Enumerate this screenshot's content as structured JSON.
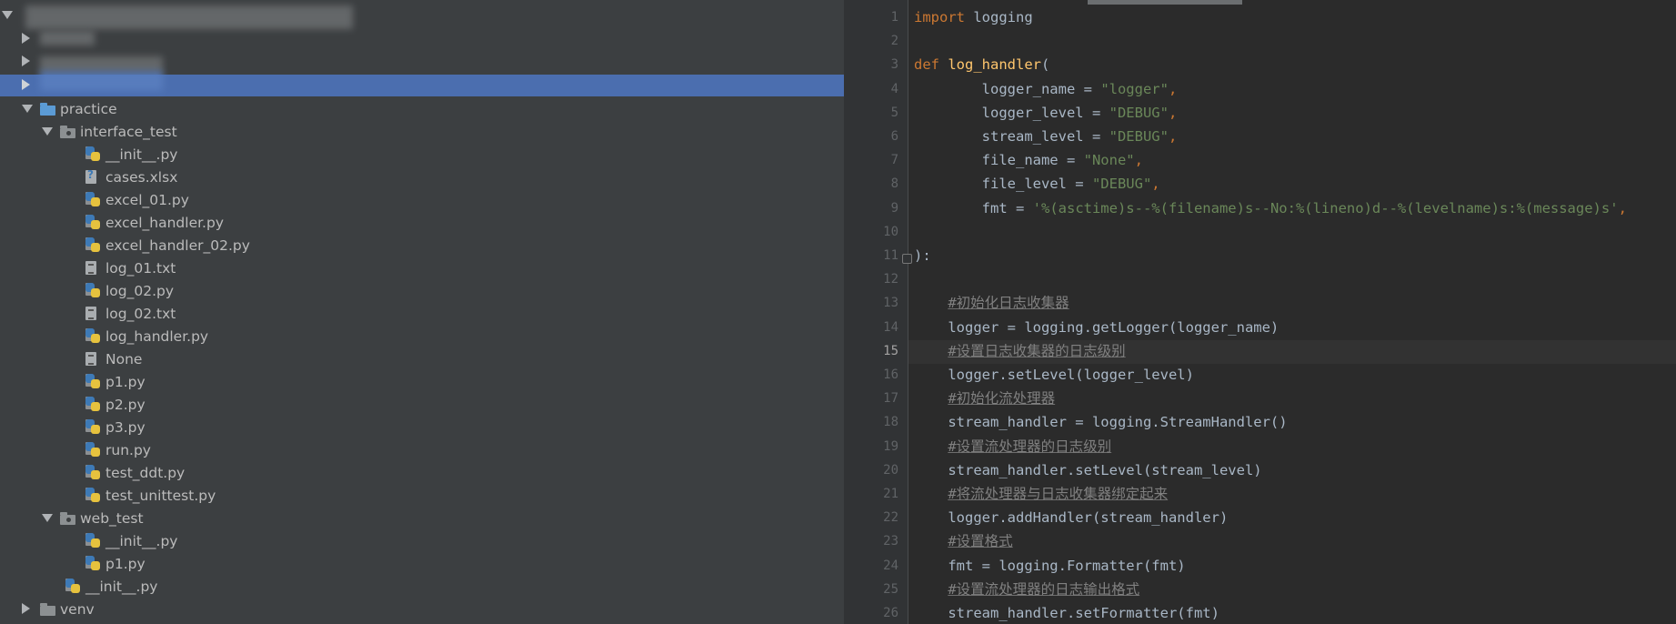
{
  "tree": {
    "items": [
      {
        "label": "practice",
        "depth": 1,
        "icon": "folder-icon",
        "arrow": "down"
      },
      {
        "label": "interface_test",
        "depth": 2,
        "icon": "package-folder-icon",
        "arrow": "down"
      },
      {
        "label": "__init__.py",
        "depth": 3,
        "icon": "python-file-icon"
      },
      {
        "label": "cases.xlsx",
        "depth": 3,
        "icon": "unknown-file-icon"
      },
      {
        "label": "excel_01.py",
        "depth": 3,
        "icon": "python-file-icon"
      },
      {
        "label": "excel_handler.py",
        "depth": 3,
        "icon": "python-file-icon"
      },
      {
        "label": "excel_handler_02.py",
        "depth": 3,
        "icon": "python-file-icon"
      },
      {
        "label": "log_01.txt",
        "depth": 3,
        "icon": "text-file-icon"
      },
      {
        "label": "log_02.py",
        "depth": 3,
        "icon": "python-file-icon"
      },
      {
        "label": "log_02.txt",
        "depth": 3,
        "icon": "text-file-icon"
      },
      {
        "label": "log_handler.py",
        "depth": 3,
        "icon": "python-file-icon"
      },
      {
        "label": "None",
        "depth": 3,
        "icon": "plain-file-icon"
      },
      {
        "label": "p1.py",
        "depth": 3,
        "icon": "python-file-icon"
      },
      {
        "label": "p2.py",
        "depth": 3,
        "icon": "python-file-icon"
      },
      {
        "label": "p3.py",
        "depth": 3,
        "icon": "python-file-icon"
      },
      {
        "label": "run.py",
        "depth": 3,
        "icon": "python-file-icon"
      },
      {
        "label": "test_ddt.py",
        "depth": 3,
        "icon": "python-file-icon"
      },
      {
        "label": "test_unittest.py",
        "depth": 3,
        "icon": "python-file-icon"
      },
      {
        "label": "web_test",
        "depth": 2,
        "icon": "package-folder-icon",
        "arrow": "down"
      },
      {
        "label": "__init__.py",
        "depth": 3,
        "icon": "python-file-icon"
      },
      {
        "label": "p1.py",
        "depth": 3,
        "icon": "python-file-icon"
      },
      {
        "label": "__init__.py",
        "depth": 2,
        "icon": "python-file-icon"
      },
      {
        "label": "venv",
        "depth": 1,
        "icon": "grey-folder-icon",
        "arrow": "right"
      }
    ]
  },
  "editor": {
    "current_line": "15",
    "colors": {
      "keyword": "#cc7832",
      "function": "#ffc66d",
      "string": "#6a8759",
      "comment": "#808080",
      "text": "#a9b7c6"
    },
    "lines": [
      {
        "n": "1",
        "tokens": [
          [
            "kw",
            "import"
          ],
          [
            "t",
            " logging"
          ]
        ]
      },
      {
        "n": "2",
        "tokens": []
      },
      {
        "n": "3",
        "tokens": [
          [
            "kw",
            "def"
          ],
          [
            "t",
            " "
          ],
          [
            "fn",
            "log_handler"
          ],
          [
            "t",
            "("
          ]
        ]
      },
      {
        "n": "4",
        "tokens": [
          [
            "t",
            "        logger_name = "
          ],
          [
            "str",
            "\"logger\""
          ],
          [
            "kw",
            ","
          ]
        ]
      },
      {
        "n": "5",
        "tokens": [
          [
            "t",
            "        logger_level = "
          ],
          [
            "str",
            "\"DEBUG\""
          ],
          [
            "kw",
            ","
          ]
        ]
      },
      {
        "n": "6",
        "tokens": [
          [
            "t",
            "        stream_level = "
          ],
          [
            "str",
            "\"DEBUG\""
          ],
          [
            "kw",
            ","
          ]
        ]
      },
      {
        "n": "7",
        "tokens": [
          [
            "t",
            "        file_name = "
          ],
          [
            "str",
            "\"None\""
          ],
          [
            "kw",
            ","
          ]
        ]
      },
      {
        "n": "8",
        "tokens": [
          [
            "t",
            "        file_level = "
          ],
          [
            "str",
            "\"DEBUG\""
          ],
          [
            "kw",
            ","
          ]
        ]
      },
      {
        "n": "9",
        "tokens": [
          [
            "t",
            "        fmt = "
          ],
          [
            "str",
            "'%(asctime)s--%(filename)s--No:%(lineno)d--%(levelname)s:%(message)s'"
          ],
          [
            "kw",
            ","
          ]
        ]
      },
      {
        "n": "10",
        "tokens": []
      },
      {
        "n": "11",
        "tokens": [
          [
            "t",
            "):"
          ]
        ]
      },
      {
        "n": "12",
        "tokens": []
      },
      {
        "n": "13",
        "tokens": [
          [
            "t",
            "    "
          ],
          [
            "cm",
            "#初始化日志收集器"
          ]
        ]
      },
      {
        "n": "14",
        "tokens": [
          [
            "t",
            "    logger = logging.getLogger(logger_name)"
          ]
        ]
      },
      {
        "n": "15",
        "tokens": [
          [
            "t",
            "    "
          ],
          [
            "cm",
            "#设置日志收集器的日志级别"
          ]
        ]
      },
      {
        "n": "16",
        "tokens": [
          [
            "t",
            "    logger.setLevel(logger_level)"
          ]
        ]
      },
      {
        "n": "17",
        "tokens": [
          [
            "t",
            "    "
          ],
          [
            "cm",
            "#初始化流处理器"
          ]
        ]
      },
      {
        "n": "18",
        "tokens": [
          [
            "t",
            "    stream_handler = logging.StreamHandler()"
          ]
        ]
      },
      {
        "n": "19",
        "tokens": [
          [
            "t",
            "    "
          ],
          [
            "cm",
            "#设置流处理器的日志级别"
          ]
        ]
      },
      {
        "n": "20",
        "tokens": [
          [
            "t",
            "    stream_handler.setLevel(stream_level)"
          ]
        ]
      },
      {
        "n": "21",
        "tokens": [
          [
            "t",
            "    "
          ],
          [
            "cm",
            "#将流处理器与日志收集器绑定起来"
          ]
        ]
      },
      {
        "n": "22",
        "tokens": [
          [
            "t",
            "    logger.addHandler(stream_handler)"
          ]
        ]
      },
      {
        "n": "23",
        "tokens": [
          [
            "t",
            "    "
          ],
          [
            "cm",
            "#设置格式"
          ]
        ]
      },
      {
        "n": "24",
        "tokens": [
          [
            "t",
            "    fmt = logging.Formatter(fmt)"
          ]
        ]
      },
      {
        "n": "25",
        "tokens": [
          [
            "t",
            "    "
          ],
          [
            "cm",
            "#设置流处理器的日志输出格式"
          ]
        ]
      },
      {
        "n": "26",
        "tokens": [
          [
            "t",
            "    stream_handler.setFormatter(fmt)"
          ]
        ]
      }
    ]
  }
}
